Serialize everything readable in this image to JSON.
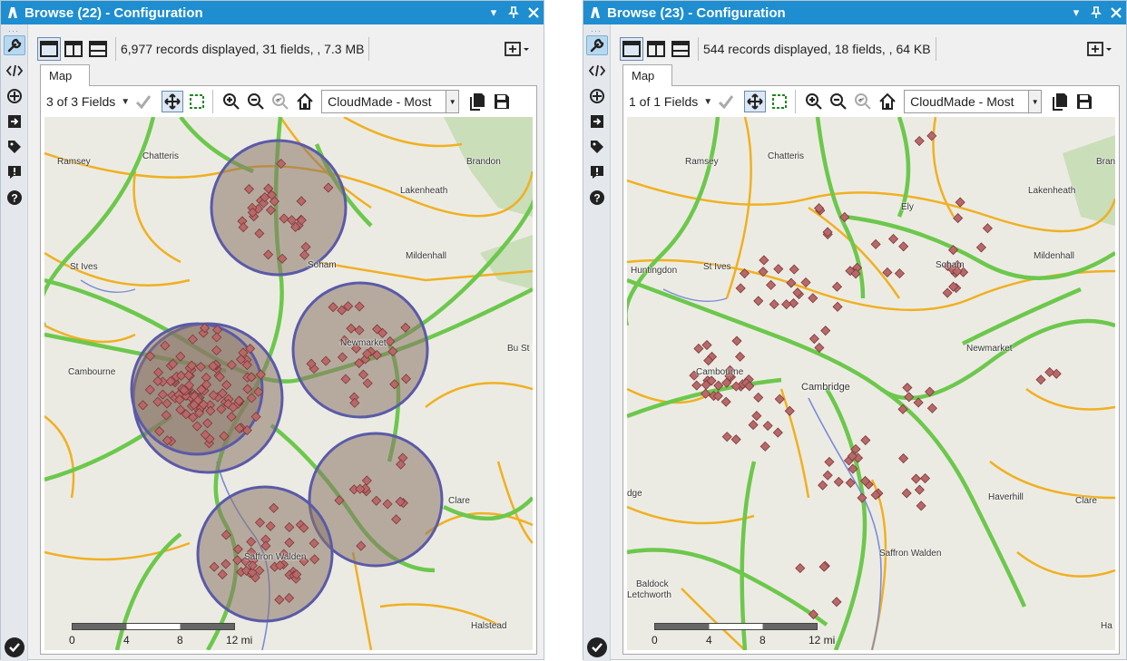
{
  "panels": [
    {
      "title": "Browse (22) - Configuration",
      "status": "6,977 records displayed, 31 fields, , 7.3 MB",
      "tab": "Map",
      "fields_selector": "3 of 3 Fields",
      "basemap": "CloudMade - Most",
      "places": [
        {
          "name": "Ramsey"
        },
        {
          "name": "Chatteris"
        },
        {
          "name": "Brandon"
        },
        {
          "name": "Lakenheath"
        },
        {
          "name": "Mildenhall"
        },
        {
          "name": "St Ives"
        },
        {
          "name": "Soham"
        },
        {
          "name": "Cambourne"
        },
        {
          "name": "Newmarket"
        },
        {
          "name": "Clare"
        },
        {
          "name": "Halstead"
        },
        {
          "name": "Saffron Walden"
        },
        {
          "name": "Bu St Ed"
        }
      ],
      "scale": {
        "ticks": [
          "0",
          "4",
          "8",
          "12 mi"
        ]
      },
      "circles_visible": true
    },
    {
      "title": "Browse (23) - Configuration",
      "status": "544 records displayed, 18 fields, , 64 KB",
      "tab": "Map",
      "fields_selector": "1 of 1 Fields",
      "basemap": "CloudMade - Most",
      "places": [
        {
          "name": "Ramsey"
        },
        {
          "name": "Chatteris"
        },
        {
          "name": "Brand"
        },
        {
          "name": "Lakenheath"
        },
        {
          "name": "Ely"
        },
        {
          "name": "Mildenhall"
        },
        {
          "name": "Huntingdon"
        },
        {
          "name": "St Ives"
        },
        {
          "name": "Soham"
        },
        {
          "name": "Newmarket"
        },
        {
          "name": "Cambourne"
        },
        {
          "name": "Cambridge"
        },
        {
          "name": "Haverhill"
        },
        {
          "name": "Clare"
        },
        {
          "name": "Saffron Walden"
        },
        {
          "name": "Baldock"
        },
        {
          "name": "Letchworth"
        },
        {
          "name": "Ha"
        },
        {
          "name": "dge"
        }
      ],
      "scale": {
        "ticks": [
          "0",
          "4",
          "8",
          "12 mi"
        ]
      },
      "circles_visible": false
    }
  ],
  "colors": {
    "titlebar": "#1e8ed0",
    "marker": "#b86868",
    "circle_fill": "#8a7468",
    "circle_stroke": "#5a5aa8",
    "road_major": "#6cc84c",
    "road_minor": "#f0b020",
    "water": "#7a8cd8"
  }
}
